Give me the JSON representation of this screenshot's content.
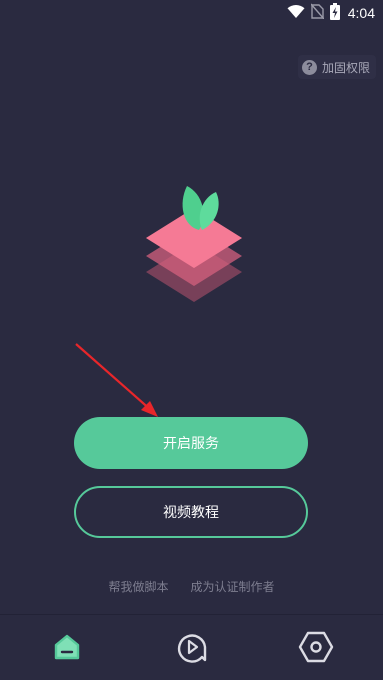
{
  "status_bar": {
    "time": "4:04",
    "icons": [
      "wifi-icon",
      "no-sim-icon",
      "battery-charging-icon"
    ]
  },
  "header": {
    "permission_icon": "question-circle-icon",
    "permission_label": "加固权限"
  },
  "logo": {
    "icon": "layered-leaf-logo"
  },
  "actions": {
    "start_service_label": "开启服务",
    "video_tutorial_label": "视频教程"
  },
  "links": {
    "help_write_script": "帮我做脚本",
    "become_author": "成为认证制作者"
  },
  "bottom_nav": {
    "items": [
      {
        "icon": "home-icon",
        "active": true
      },
      {
        "icon": "play-icon",
        "active": false
      },
      {
        "icon": "settings-hexagon-icon",
        "active": false
      }
    ]
  },
  "colors": {
    "background": "#2a2a40",
    "accent": "#56c99a",
    "logo_pink": "#f0728e",
    "arrow_red": "#e8262a",
    "muted_text": "#7e7e90"
  }
}
